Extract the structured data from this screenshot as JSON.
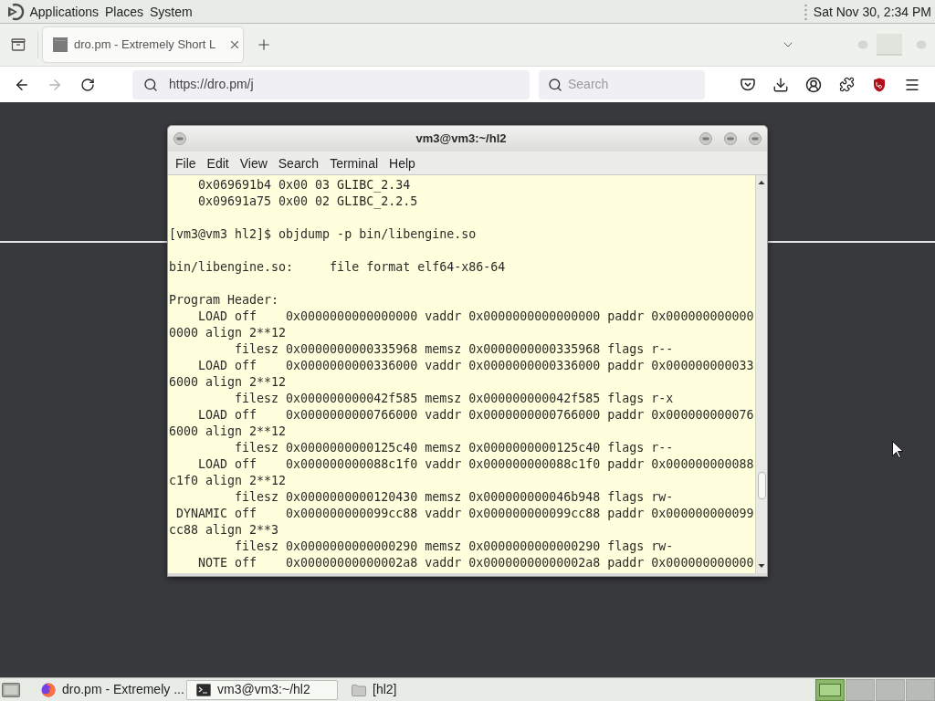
{
  "top_panel": {
    "menus": [
      "Applications",
      "Places",
      "System"
    ],
    "clock": "Sat Nov 30, 2:34 PM"
  },
  "browser": {
    "tabs": [
      {
        "title": "dro.pm - Extremely Short L",
        "selected": true
      }
    ],
    "forward_button": {
      "disabled": true
    },
    "url_field": {
      "value": "https://dro.pm/j"
    },
    "search_field": {
      "placeholder": "Search"
    }
  },
  "terminal": {
    "title": "vm3@vm3:~/hl2",
    "menu": [
      "File",
      "Edit",
      "View",
      "Search",
      "Terminal",
      "Help"
    ],
    "lines": [
      {
        "kind": "text",
        "text": "    0x069691b4 0x00 03 GLIBC_2.34"
      },
      {
        "kind": "text",
        "text": "    0x09691a75 0x00 02 GLIBC_2.2.5"
      },
      {
        "kind": "blank"
      },
      {
        "kind": "text",
        "text": "[vm3@vm3 hl2]$ objdump -p bin/libengine.so"
      },
      {
        "kind": "blank"
      },
      {
        "kind": "text",
        "text": "bin/libengine.so:     file format elf64-x86-64"
      },
      {
        "kind": "blank"
      },
      {
        "kind": "text",
        "text": "Program Header:"
      },
      {
        "kind": "text",
        "text": "    LOAD off    0x0000000000000000 vaddr 0x0000000000000000 paddr 0x000000000000"
      },
      {
        "kind": "text",
        "text": "0000 align 2**12"
      },
      {
        "kind": "text",
        "text": "         filesz 0x0000000000335968 memsz 0x0000000000335968 flags r--"
      },
      {
        "kind": "text",
        "text": "    LOAD off    0x0000000000336000 vaddr 0x0000000000336000 paddr 0x000000000033"
      },
      {
        "kind": "text",
        "text": "6000 align 2**12"
      },
      {
        "kind": "text",
        "text": "         filesz 0x000000000042f585 memsz 0x000000000042f585 flags r-x"
      },
      {
        "kind": "text",
        "text": "    LOAD off    0x0000000000766000 vaddr 0x0000000000766000 paddr 0x000000000076"
      },
      {
        "kind": "text",
        "text": "6000 align 2**12"
      },
      {
        "kind": "text",
        "text": "         filesz 0x0000000000125c40 memsz 0x0000000000125c40 flags r--"
      },
      {
        "kind": "text",
        "text": "    LOAD off    0x000000000088c1f0 vaddr 0x000000000088c1f0 paddr 0x000000000088"
      },
      {
        "kind": "text",
        "text": "c1f0 align 2**12"
      },
      {
        "kind": "text",
        "text": "         filesz 0x0000000000120430 memsz 0x000000000046b948 flags rw-"
      },
      {
        "kind": "text",
        "text": " DYNAMIC off    0x000000000099cc88 vaddr 0x000000000099cc88 paddr 0x000000000099"
      },
      {
        "kind": "text",
        "text": "cc88 align 2**3"
      },
      {
        "kind": "text",
        "text": "         filesz 0x0000000000000290 memsz 0x0000000000000290 flags rw-"
      },
      {
        "kind": "text",
        "text": "    NOTE off    0x00000000000002a8 vaddr 0x00000000000002a8 paddr 0x000000000000"
      }
    ]
  },
  "taskbar": {
    "items": [
      {
        "kind": "browser",
        "label": "dro.pm - Extremely ...",
        "selected": false
      },
      {
        "kind": "terminal",
        "label": "vm3@vm3:~/hl2",
        "selected": true
      },
      {
        "kind": "folder",
        "label": "[hl2]",
        "selected": false
      }
    ],
    "workspaces": [
      {
        "selected": true
      },
      {
        "selected": false
      },
      {
        "selected": false
      },
      {
        "selected": false
      }
    ]
  }
}
